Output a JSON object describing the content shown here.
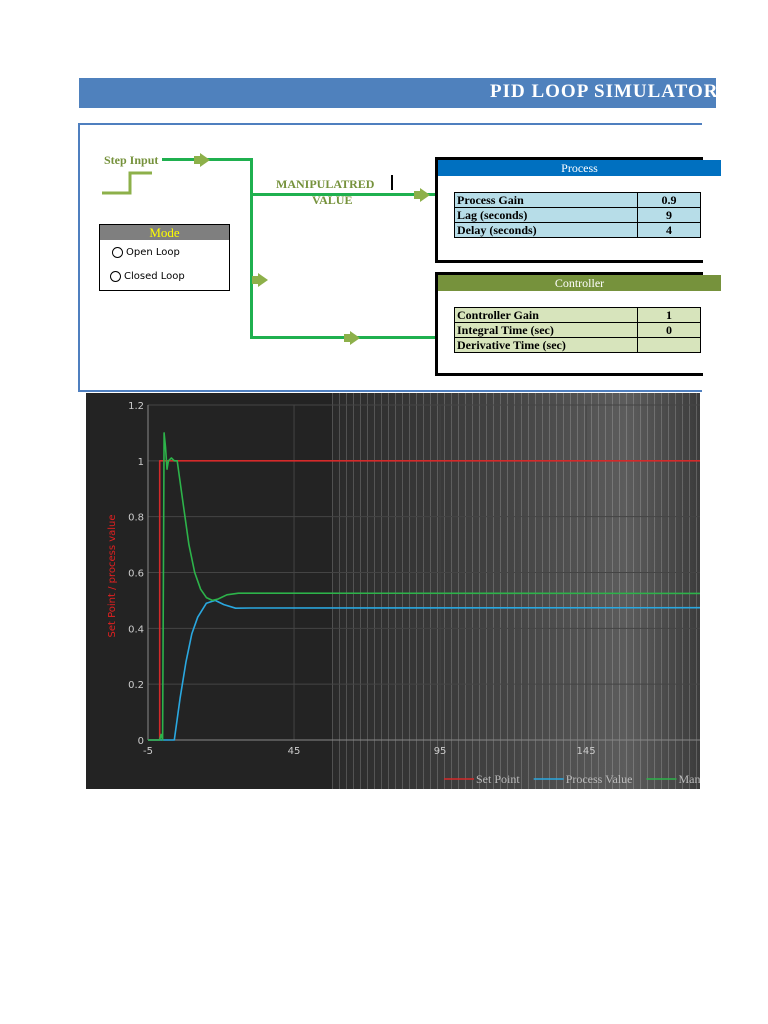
{
  "header": {
    "title": "PID LOOP SIMULATOR"
  },
  "diagram": {
    "step_input_label": "Step Input",
    "mv_label_line1": "MANIPULATRED",
    "mv_label_line2": "VALUE"
  },
  "mode": {
    "title": "Mode",
    "options": [
      {
        "label": "Open Loop",
        "selected": false
      },
      {
        "label": "Closed Loop",
        "selected": false
      }
    ]
  },
  "process": {
    "title": "Process",
    "color": "#0070c0",
    "rows": [
      {
        "label": "Process Gain",
        "value": "0.9"
      },
      {
        "label": "Lag (seconds)",
        "value": "9"
      },
      {
        "label": "Delay (seconds)",
        "value": "4"
      }
    ]
  },
  "controller": {
    "title": "Controller",
    "color": "#76923c",
    "rows": [
      {
        "label": "Controller Gain",
        "value": "1"
      },
      {
        "label": "Integral Time (sec)",
        "value": "0"
      },
      {
        "label": "Derivative Time (sec)",
        "value": ""
      }
    ]
  },
  "chart_data": {
    "type": "line",
    "title": "",
    "xlabel": "",
    "ylabel": "Set Point / process value",
    "xlim": [
      -5,
      184
    ],
    "ylim": [
      0,
      1.2
    ],
    "xticks": [
      "-5",
      "45",
      "95",
      "145"
    ],
    "xtick_values": [
      -5,
      45,
      95,
      145
    ],
    "yticks": [
      "0",
      "0.2",
      "0.4",
      "0.6",
      "0.8",
      "1",
      "1.2"
    ],
    "ytick_values": [
      0,
      0.2,
      0.4,
      0.6,
      0.8,
      1,
      1.2
    ],
    "grid": true,
    "legend_placement": "bottom-right",
    "series": [
      {
        "name": "Set Point",
        "color": "#d42a2a",
        "x": [
          -5,
          -1,
          -1,
          184
        ],
        "y": [
          0,
          0,
          1,
          1
        ]
      },
      {
        "name": "Process Value",
        "color": "#2aa8e0",
        "x": [
          -5,
          4,
          6,
          8,
          10,
          12,
          15,
          18,
          21,
          25,
          30,
          184
        ],
        "y": [
          0,
          0,
          0.15,
          0.28,
          0.38,
          0.44,
          0.49,
          0.5,
          0.485,
          0.472,
          0.473,
          0.474
        ]
      },
      {
        "name": "Manipulated Value",
        "color": "#2db34a",
        "x": [
          -5,
          -1,
          -0.5,
          0,
          0.5,
          1,
          1.5,
          2,
          3,
          4,
          5,
          7,
          9,
          11,
          13,
          15,
          17,
          19,
          22,
          26,
          184
        ],
        "y": [
          0,
          0,
          0.02,
          0,
          1.1,
          1.05,
          0.97,
          1.0,
          1.01,
          1.0,
          1.0,
          0.85,
          0.7,
          0.6,
          0.54,
          0.51,
          0.5,
          0.505,
          0.52,
          0.526,
          0.525
        ]
      }
    ]
  }
}
